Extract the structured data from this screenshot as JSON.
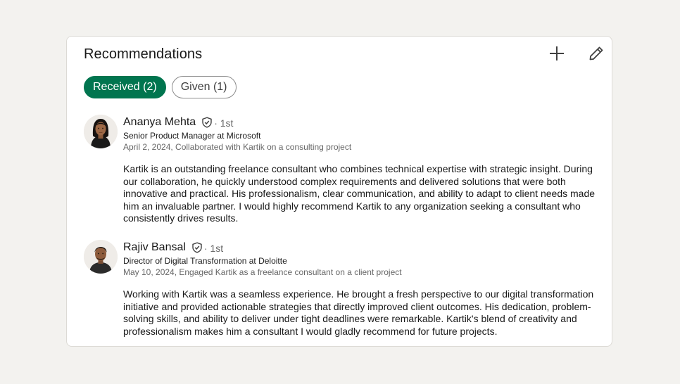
{
  "card": {
    "title": "Recommendations"
  },
  "tabs": [
    {
      "label": "Received (2)",
      "active": true
    },
    {
      "label": "Given (1)",
      "active": false
    }
  ],
  "recommendations": [
    {
      "name": "Ananya Mehta",
      "degree": "· 1st",
      "headline": "Senior Product Manager at Microsoft",
      "meta": "April 2, 2024, Collaborated with Kartik on a consulting project",
      "text": "Kartik is an outstanding freelance consultant who combines technical expertise with strategic insight. During our collaboration, he quickly understood complex requirements and delivered solutions that were both innovative and practical. His professionalism, clear communication, and ability to adapt to client needs made him an invaluable partner. I would highly recommend Kartik to any organization seeking a consultant who consistently drives results."
    },
    {
      "name": "Rajiv Bansal",
      "degree": "· 1st",
      "headline": "Director of Digital Transformation at Deloitte",
      "meta": "May 10, 2024, Engaged Kartik as a freelance consultant on a client project",
      "text": "Working with Kartik was a seamless experience. He brought a fresh perspective to our digital transformation initiative and provided actionable strategies that directly improved client outcomes. His dedication, problem-solving skills, and ability to deliver under tight deadlines were remarkable. Kartik's blend of creativity and professionalism makes him a consultant I would gladly recommend for future projects."
    }
  ],
  "colors": {
    "active_tab_bg": "#01754f",
    "page_bg": "#f3f2ef",
    "card_bg": "#ffffff"
  },
  "icons": {
    "add": "plus-icon",
    "edit": "pencil-icon",
    "verified": "verified-shield-icon"
  }
}
